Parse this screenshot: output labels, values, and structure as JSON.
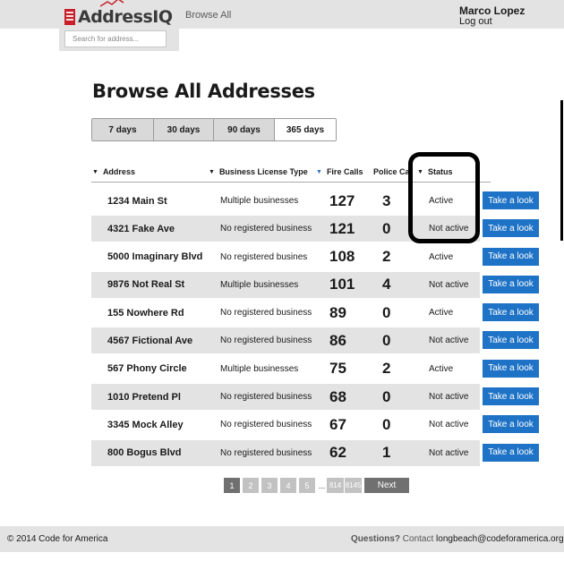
{
  "header": {
    "logo_text": "AddressIQ",
    "search_placeholder": "Search for address...",
    "browse_link": "Browse All",
    "user_name": "Marco Lopez",
    "logout_link": "Log out"
  },
  "page": {
    "title": "Browse All Addresses",
    "range_tabs": [
      "7 days",
      "30 days",
      "90 days",
      "365 days"
    ],
    "selected_range": "365 days"
  },
  "table": {
    "columns": [
      "Address",
      "Business License Type",
      "Fire Calls",
      "Police Ca",
      "Status"
    ],
    "action_label": "Take a look",
    "rows": [
      {
        "address": "1234 Main St",
        "license": "Multiple businesses",
        "fire": "127",
        "police": "3",
        "status": "Active"
      },
      {
        "address": "4321 Fake Ave",
        "license": "No registered business",
        "fire": "121",
        "police": "0",
        "status": "Not active"
      },
      {
        "address": "5000 Imaginary Blvd",
        "license": "No registered busines",
        "fire": "108",
        "police": "2",
        "status": "Active"
      },
      {
        "address": "9876 Not Real St",
        "license": "Multiple businesses",
        "fire": "101",
        "police": "4",
        "status": "Not active"
      },
      {
        "address": "155 Nowhere Rd",
        "license": "No registered business",
        "fire": "89",
        "police": "0",
        "status": "Active"
      },
      {
        "address": "4567 Fictional Ave",
        "license": "No registered business",
        "fire": "86",
        "police": "0",
        "status": "Not active"
      },
      {
        "address": "567 Phony Circle",
        "license": "Multiple businesses",
        "fire": "75",
        "police": "2",
        "status": "Active"
      },
      {
        "address": "1010 Pretend Pl",
        "license": "No registered business",
        "fire": "68",
        "police": "0",
        "status": "Not active"
      },
      {
        "address": "3345 Mock Alley",
        "license": "No registered business",
        "fire": "67",
        "police": "0",
        "status": "Not active"
      },
      {
        "address": "800 Bogus Blvd",
        "license": "No registered business",
        "fire": "62",
        "police": "1",
        "status": "Not active"
      }
    ]
  },
  "pagination": {
    "pages": [
      "1",
      "2",
      "3",
      "4",
      "5"
    ],
    "ellipsis": "...",
    "last_pages": [
      "814",
      "8145"
    ],
    "current": "1",
    "next_label": "Next"
  },
  "footer": {
    "copyright": "© 2014 Code for America",
    "questions": "Questions?",
    "contact": "Contact",
    "email": "longbeach@codeforamerica.org"
  },
  "colors": {
    "accent_button": "#1f73c6",
    "header_bg": "#e3e3e3",
    "logo_red": "#c8202a",
    "sort_caret_active": "#2a72c3"
  }
}
